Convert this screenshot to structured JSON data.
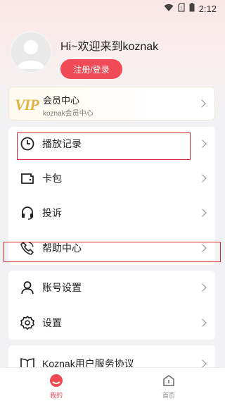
{
  "status_bar": {
    "time": "2:12",
    "icons": [
      "wifi-icon",
      "no-sim-icon",
      "battery-icon"
    ]
  },
  "profile": {
    "greeting": "Hi~欢迎来到koznak",
    "login_button": "注册/登录",
    "avatar_icon": "default-avatar-icon"
  },
  "vip": {
    "logo": "VIP",
    "title": "会员中心",
    "subtitle": "koznak会员中心"
  },
  "menu_group_1": [
    {
      "label": "播放记录",
      "icon": "clock-icon"
    },
    {
      "label": "卡包",
      "icon": "wallet-icon"
    },
    {
      "label": "投诉",
      "icon": "headset-icon"
    },
    {
      "label": "帮助中心",
      "icon": "phone-help-icon"
    }
  ],
  "menu_group_2": [
    {
      "label": "账号设置",
      "icon": "user-icon"
    },
    {
      "label": "设置",
      "icon": "gear-icon"
    }
  ],
  "menu_group_3": [
    {
      "label": "Koznak用户服务协议",
      "icon": "book-icon"
    }
  ],
  "tabbar": {
    "tabs": [
      {
        "label": "我的",
        "icon": "mine-icon",
        "active": true
      },
      {
        "label": "首页",
        "icon": "home-icon",
        "active": false
      }
    ]
  },
  "colors": {
    "accent": "#ef4a55",
    "highlight_box": "#d9252e",
    "vip_gold": "#e0b440"
  }
}
